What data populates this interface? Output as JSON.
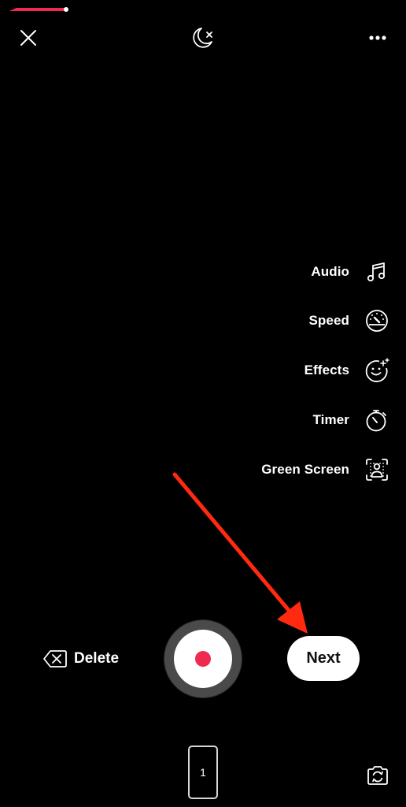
{
  "recording": {
    "progress_fraction": 0.1,
    "progress_color": "#ee2a50"
  },
  "top_bar": {
    "close_icon": "close-icon",
    "night_mode_icon": "moon-off-icon",
    "more_icon": "more-horizontal-icon"
  },
  "tools": [
    {
      "label": "Audio",
      "icon": "music-note-icon"
    },
    {
      "label": "Speed",
      "icon": "speedometer-icon"
    },
    {
      "label": "Effects",
      "icon": "smiley-sparkle-icon"
    },
    {
      "label": "Timer",
      "icon": "stopwatch-icon"
    },
    {
      "label": "Green Screen",
      "icon": "green-screen-icon"
    }
  ],
  "controls": {
    "delete_label": "Delete",
    "record_color": "#ee2a50",
    "next_label": "Next",
    "clip_count": "1",
    "flip_camera_icon": "camera-flip-icon"
  },
  "annotation": {
    "arrow_color": "#ff2a10",
    "points_to": "Next"
  }
}
